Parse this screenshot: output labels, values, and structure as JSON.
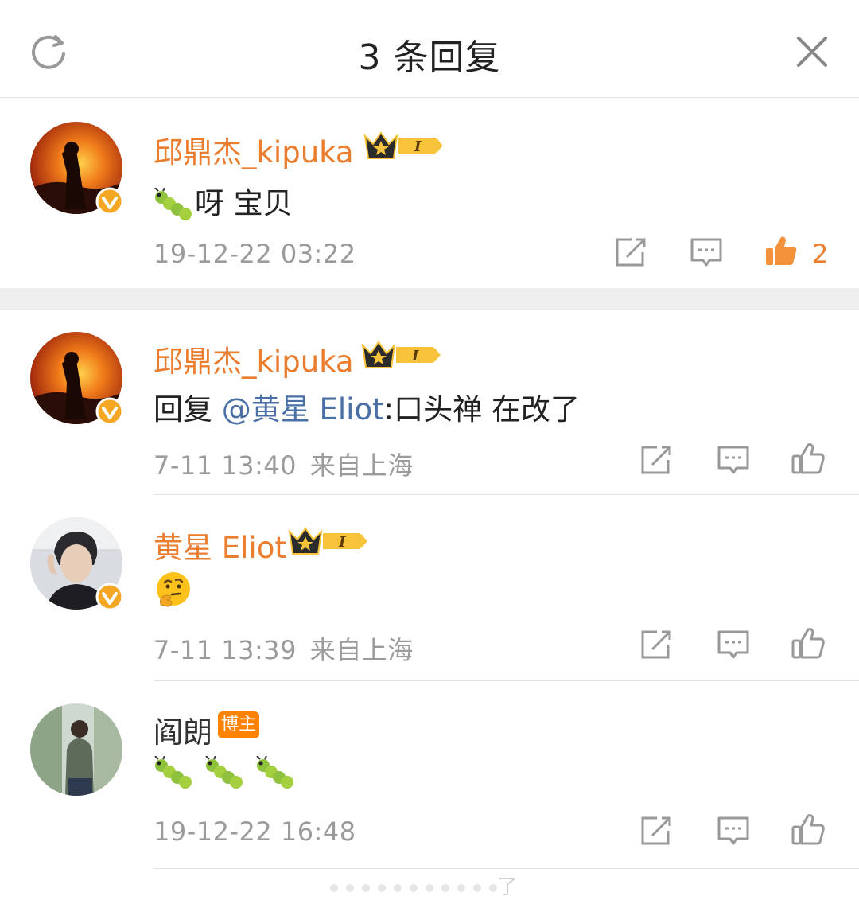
{
  "header": {
    "title": "3 条回复",
    "refresh_icon": "refresh-icon",
    "close_icon": "close-icon"
  },
  "main_comment": {
    "username": "邱鼎杰_kipuka",
    "text": "呀 宝贝",
    "time": "19-12-22 03:22",
    "like_count": "2"
  },
  "replies": [
    {
      "username": "邱鼎杰_kipuka",
      "reply_prefix": "回复",
      "mention": "@黄星 Eliot",
      "colon": ":",
      "text": "口头禅 在改了",
      "time": "7-11 13:40",
      "location": "来自上海"
    },
    {
      "username": "黄星 Eliot",
      "time": "7-11 13:39",
      "location": "来自上海"
    },
    {
      "username": "阎朗",
      "badge": "博主",
      "time": "19-12-22 16:48"
    }
  ],
  "footer_hint": "了",
  "colors": {
    "accent": "#eb7d2f",
    "mention": "#4a6fa5",
    "muted": "#9b9b9b"
  }
}
